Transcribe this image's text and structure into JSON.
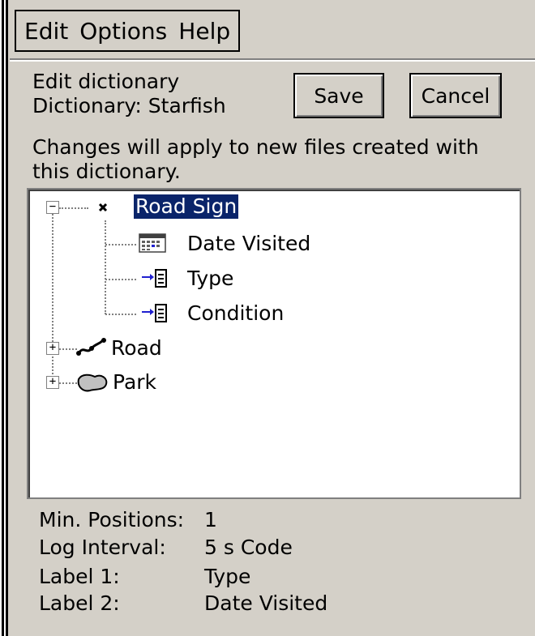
{
  "menu": {
    "items": [
      {
        "label": "Edit"
      },
      {
        "label": "Options"
      },
      {
        "label": "Help"
      }
    ]
  },
  "header": {
    "title": "Edit dictionary",
    "dictionary": "Dictionary: Starfish",
    "save_label": "Save",
    "cancel_label": "Cancel",
    "notice": "Changes will apply to new files created with",
    "notice_line2": "this dictionary."
  },
  "tree": {
    "nodes": [
      {
        "label": "Road Sign",
        "icon": "point-feature-icon",
        "expanded": true,
        "selected": true,
        "children": [
          {
            "label": "Date Visited",
            "icon": "date-field-icon"
          },
          {
            "label": "Type",
            "icon": "menu-field-icon"
          },
          {
            "label": "Condition",
            "icon": "menu-field-icon"
          }
        ]
      },
      {
        "label": "Road",
        "icon": "line-feature-icon",
        "expanded": false
      },
      {
        "label": "Park",
        "icon": "area-feature-icon",
        "expanded": false
      }
    ]
  },
  "properties": [
    {
      "label": "Min. Positions:",
      "value": "1"
    },
    {
      "label": "Log Interval:",
      "value": "5 s Code"
    },
    {
      "label": "Label 1:",
      "value": "Type"
    },
    {
      "label": "Label 2:",
      "value": "Date Visited"
    }
  ],
  "colors": {
    "selection": "#0a246a",
    "background": "#d4d0c8"
  }
}
